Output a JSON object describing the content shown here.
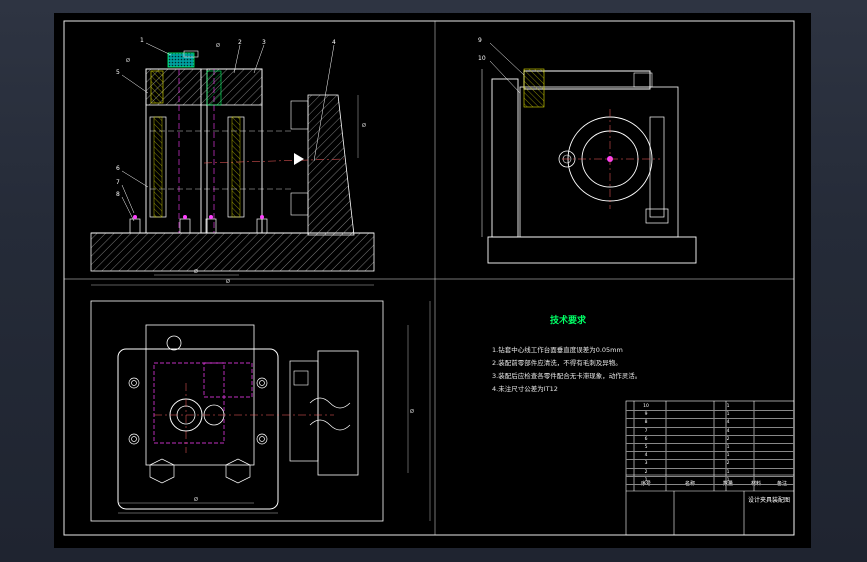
{
  "drawing": {
    "balloons_front": [
      "1",
      "2",
      "3",
      "4",
      "5",
      "6",
      "7",
      "8"
    ],
    "balloons_side": [
      "9",
      "10"
    ],
    "dims_front": [
      "Ø",
      "Ø",
      "Ø",
      "Ø",
      "Ø"
    ],
    "dims_plan": [
      "Ø",
      "Ø"
    ],
    "tech": {
      "title": "技术要求",
      "notes": [
        "1.钻套中心线工作台面垂直度误差为0.05mm",
        "2.装配前零部件应清洗，不得有毛刺及异物。",
        "3.装配后应检查各零件配合无卡滞现象，动作灵活。",
        "4.未注尺寸公差为IT12"
      ]
    },
    "title_block": {
      "name": "设计夹具装配图",
      "headers": [
        "序号",
        "名称",
        "数量",
        "材料",
        "备注"
      ],
      "rows": [
        [
          "10",
          "",
          "1",
          "",
          ""
        ],
        [
          "9",
          "",
          "1",
          "",
          ""
        ],
        [
          "8",
          "",
          "4",
          "",
          ""
        ],
        [
          "7",
          "",
          "4",
          "",
          ""
        ],
        [
          "6",
          "",
          "2",
          "",
          ""
        ],
        [
          "5",
          "",
          "1",
          "",
          ""
        ],
        [
          "4",
          "",
          "1",
          "",
          ""
        ],
        [
          "3",
          "",
          "2",
          "",
          ""
        ],
        [
          "2",
          "",
          "1",
          "",
          ""
        ],
        [
          "1",
          "",
          "1",
          "",
          ""
        ]
      ]
    }
  }
}
